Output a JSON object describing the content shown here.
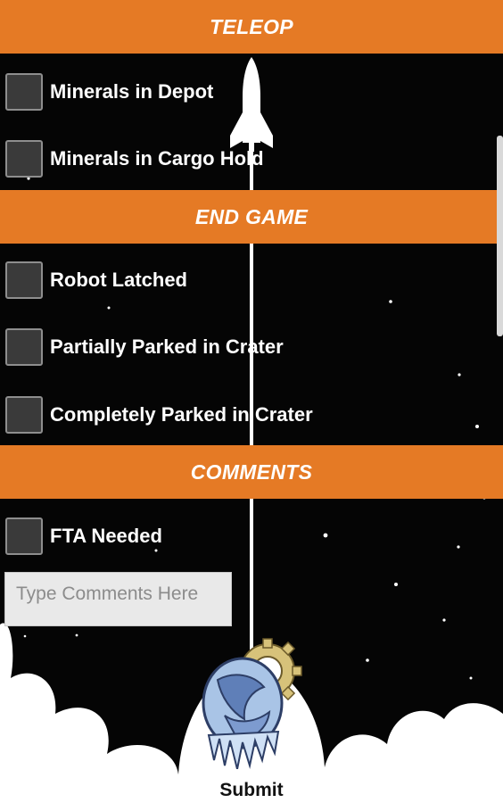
{
  "colors": {
    "header_bg": "#e57a25",
    "header_text": "#ffffff",
    "background": "#050505",
    "cloud": "#ffffff",
    "checkbox_fill": "#3a3a3a"
  },
  "sections": {
    "teleop": {
      "title": "TELEOP",
      "items": [
        {
          "label": "Minerals in Depot",
          "checked": false
        },
        {
          "label": "Minerals in Cargo Hold",
          "checked": false
        }
      ]
    },
    "end_game": {
      "title": "END GAME",
      "items": [
        {
          "label": "Robot Latched",
          "checked": false
        },
        {
          "label": "Partially Parked in Crater",
          "checked": false
        },
        {
          "label": "Completely Parked in Crater",
          "checked": false
        }
      ]
    },
    "comments": {
      "title": "COMMENTS",
      "items": [
        {
          "label": "FTA Needed",
          "checked": false
        }
      ],
      "input_placeholder": "Type Comments Here",
      "input_value": ""
    }
  },
  "submit": {
    "label": "Submit",
    "icon": "team-logo-icon"
  },
  "background_art": {
    "rocket": "rocket-icon",
    "stars": "starfield",
    "clouds": "cloud-graphic"
  }
}
